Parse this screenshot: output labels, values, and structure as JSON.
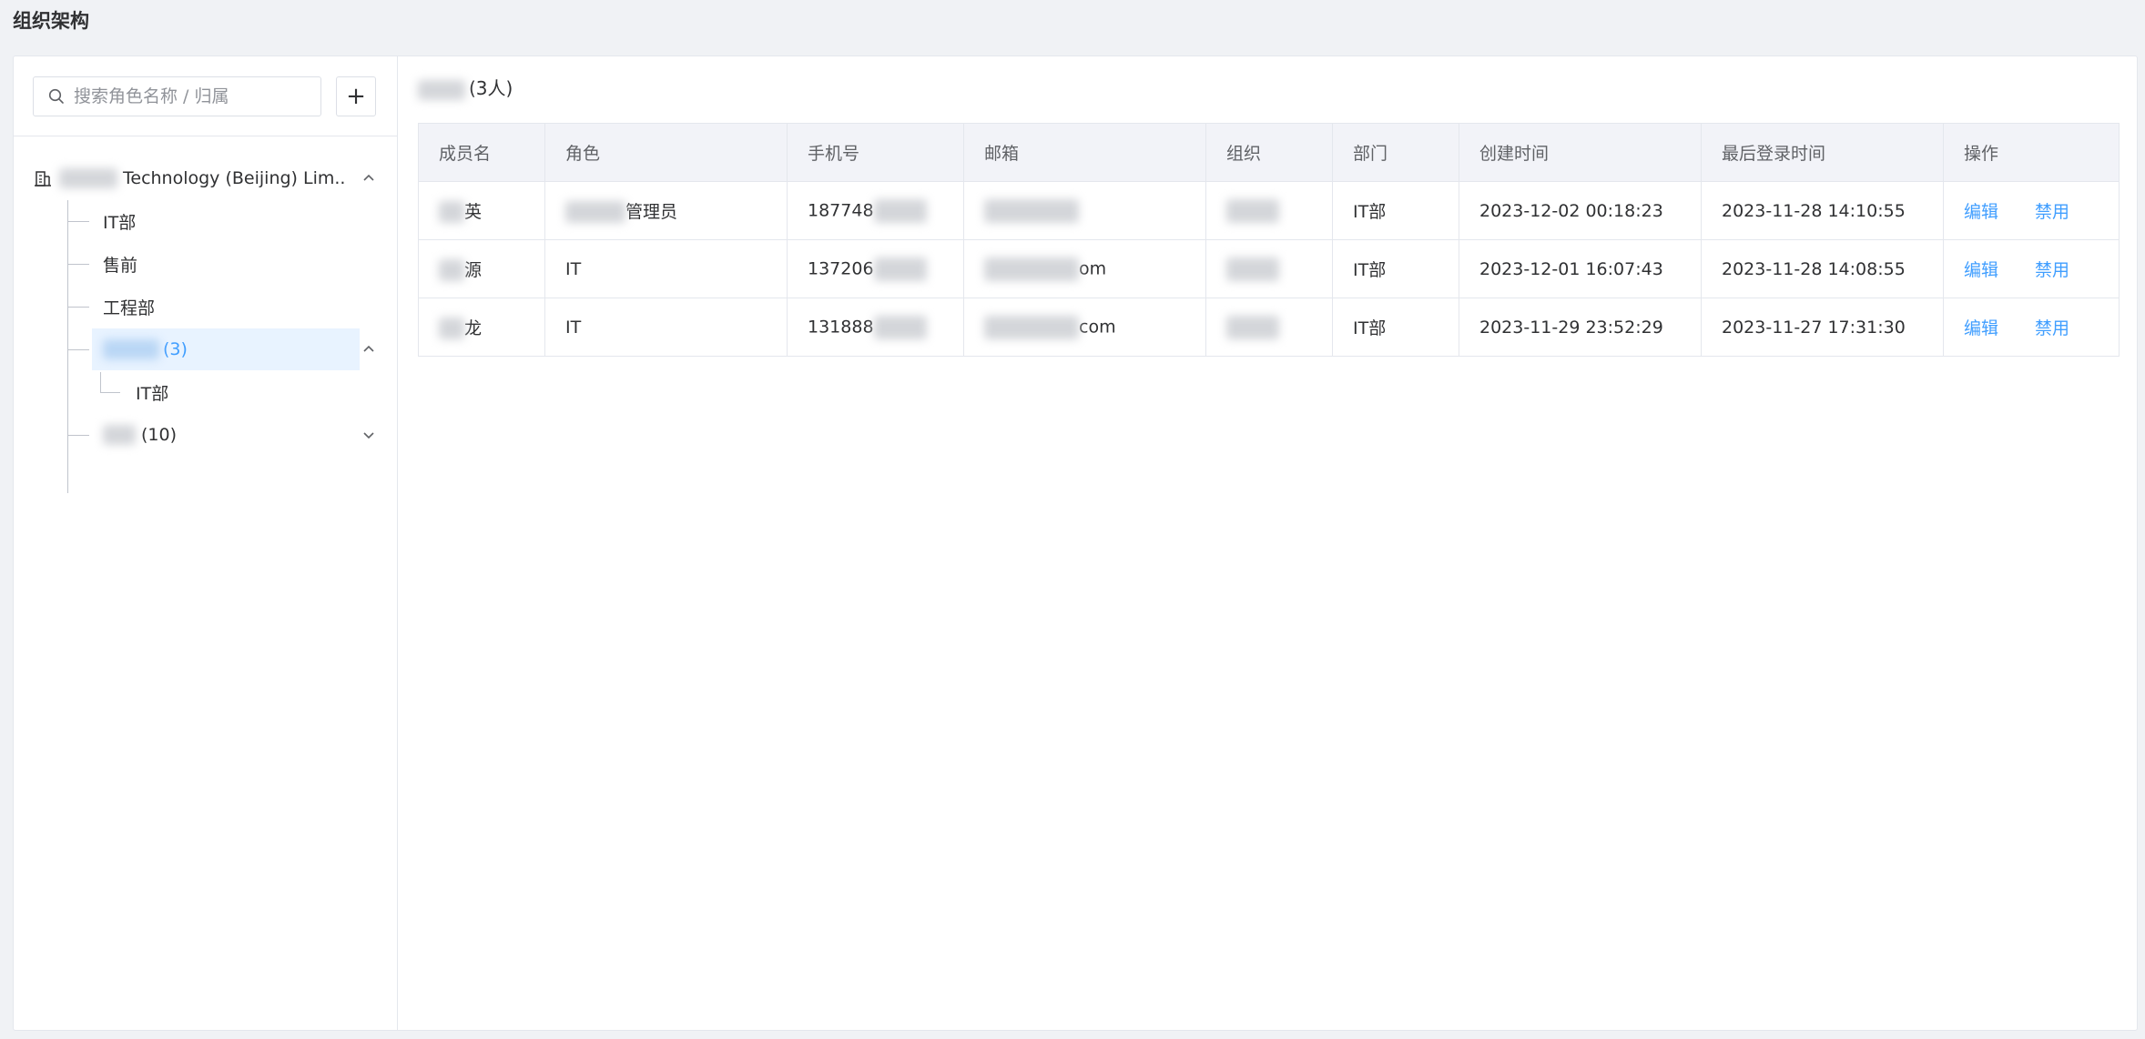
{
  "page": {
    "title": "组织架构"
  },
  "search": {
    "placeholder": "搜索角色名称 / 归属",
    "value": ""
  },
  "add_label": "+",
  "tree": {
    "root": {
      "label": "Technology (Beijing) Lim.."
    },
    "items": [
      {
        "label": "IT部"
      },
      {
        "label": "售前"
      },
      {
        "label": "工程部"
      },
      {
        "label": "(3)"
      },
      {
        "label": "IT部"
      },
      {
        "label": "(10)"
      }
    ]
  },
  "panel": {
    "title": "(3人)"
  },
  "table": {
    "headers": [
      "成员名",
      "角色",
      "手机号",
      "邮箱",
      "组织",
      "部门",
      "创建时间",
      "最后登录时间",
      "操作"
    ],
    "rows": [
      {
        "name": "英",
        "role": "管理员",
        "phone": "187748",
        "email": "",
        "org": "",
        "dept": "IT部",
        "created": "2023-12-02 00:18:23",
        "last_login": "2023-11-28 14:10:55",
        "edit": "编辑",
        "disable": "禁用"
      },
      {
        "name": "源",
        "role": "IT",
        "phone": "137206",
        "email": "om",
        "org": "",
        "dept": "IT部",
        "created": "2023-12-01 16:07:43",
        "last_login": "2023-11-28 14:08:55",
        "edit": "编辑",
        "disable": "禁用"
      },
      {
        "name": "龙",
        "role": "IT",
        "phone": "131888",
        "email": "com",
        "org": "",
        "dept": "IT部",
        "created": "2023-11-29 23:52:29",
        "last_login": "2023-11-27 17:31:30",
        "edit": "编辑",
        "disable": "禁用"
      }
    ]
  },
  "colors": {
    "accent": "#409eff",
    "active_bg": "#e8f3ff",
    "header_bg": "#f2f3f8"
  }
}
